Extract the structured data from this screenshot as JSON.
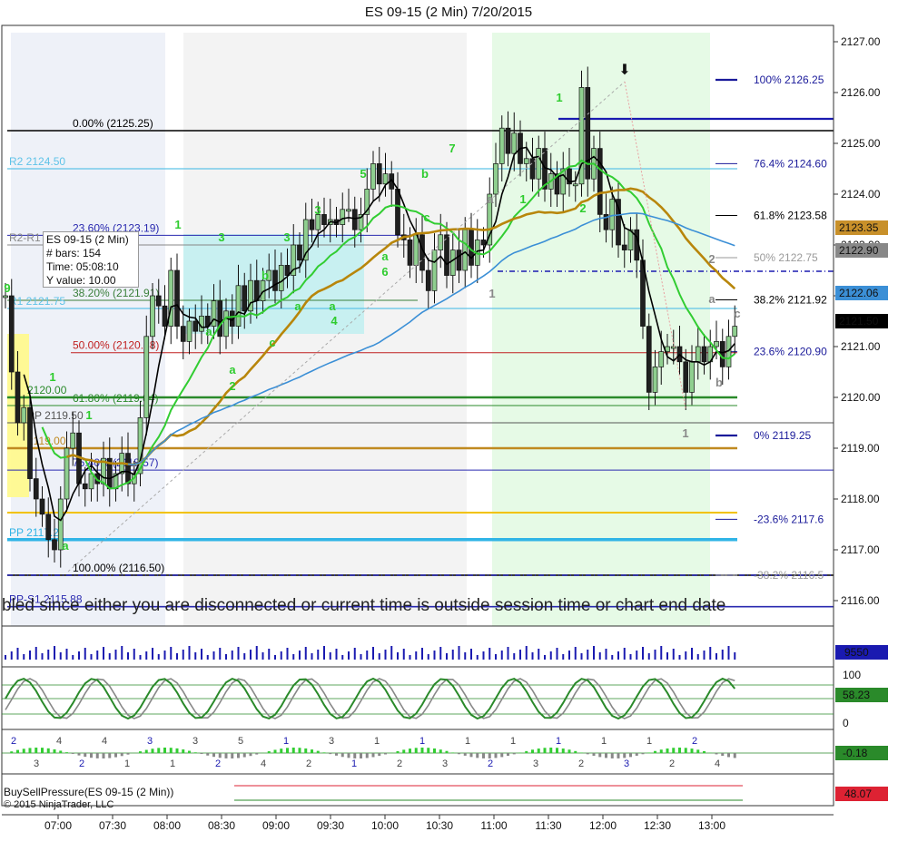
{
  "window": {
    "title": "ES 09-15 (2 Min)  7/20/2015"
  },
  "info_box": {
    "title": "ES 09-15 (2 Min)",
    "bars_label": "# bars:",
    "bars_value": "154",
    "time_label": "Time:",
    "time_value": "05:08:10",
    "yvalue_label": "Y value:",
    "yvalue_value": "10.00"
  },
  "banner": "bled since either you are disconnected or current time is outside session time or chart end date",
  "copyright": "© 2015 NinjaTrader, LLC",
  "colors": {
    "candle_up": "#8fcf8f",
    "candle_down": "#1f1f1f",
    "sma_short": "#000000",
    "sma_green": "#32cd32",
    "sma_brown": "#b8860b",
    "sma_blue": "#3b8fd6",
    "zone_lightblue": "#bfeff0",
    "zone_green": "#e6fae6",
    "zone_gray": "#f3f3f3",
    "zone_yellow": "#fff98a"
  },
  "chart_data": {
    "type": "candlestick",
    "instrument": "ES 09-15",
    "interval": "2 Min",
    "date": "7/20/2015",
    "ylim": [
      2115.9,
      2127.2
    ],
    "y_ticks": [
      "2127.00",
      "2126.00",
      "2125.00",
      "2124.00",
      "2123.00",
      "2122.00",
      "2121.00",
      "2120.00",
      "2119.00",
      "2118.00",
      "2117.00",
      "2116.00"
    ],
    "x_ticks": [
      "07:00",
      "07:30",
      "08:00",
      "08:30",
      "09:00",
      "09:30",
      "10:00",
      "10:30",
      "11:00",
      "11:30",
      "12:00",
      "12:30",
      "13:00"
    ],
    "close_path": [
      2122.0,
      2120.5,
      2119.5,
      2119.8,
      2118.4,
      2118.0,
      2117.7,
      2117.2,
      2117.0,
      2118.0,
      2119.0,
      2119.3,
      2118.3,
      2118.2,
      2118.5,
      2118.3,
      2118.8,
      2118.2,
      2118.5,
      2118.9,
      2118.3,
      2118.5,
      2119.6,
      2121.2,
      2122.0,
      2121.8,
      2121.4,
      2122.5,
      2121.4,
      2121.1,
      2121.5,
      2121.3,
      2121.6,
      2121.4,
      2121.9,
      2121.2,
      2121.7,
      2121.4,
      2122.2,
      2121.7,
      2122.3,
      2121.9,
      2122.3,
      2122.5,
      2122.1,
      2122.6,
      2122.4,
      2123.0,
      2122.7,
      2123.5,
      2123.3,
      2123.6,
      2123.4,
      2123.5,
      2123.4,
      2123.7,
      2123.7,
      2123.3,
      2123.6,
      2124.1,
      2124.6,
      2124.2,
      2124.4,
      2124.1,
      2123.2,
      2123.1,
      2122.6,
      2123.2,
      2122.5,
      2122.1,
      2122.9,
      2123.2,
      2122.4,
      2122.9,
      2122.5,
      2123.3,
      2122.6,
      2123.1,
      2123.0,
      2124.0,
      2124.6,
      2125.3,
      2124.8,
      2125.2,
      2124.6,
      2124.7,
      2124.3,
      2124.9,
      2124.1,
      2124.4,
      2124.0,
      2124.5,
      2124.2,
      2124.2,
      2126.1,
      2124.3,
      2124.9,
      2123.6,
      2123.3,
      2123.9,
      2123.0,
      2122.9,
      2123.3,
      2122.7,
      2121.4,
      2120.1,
      2120.6,
      2120.9,
      2121.0,
      2121.0,
      2120.7,
      2120.1,
      2120.7,
      2121.0,
      2120.7,
      2121.0,
      2121.1,
      2120.6,
      2121.2,
      2121.4
    ],
    "x_range": [
      "06:00",
      "13:20"
    ],
    "y_panel_labels": {
      "r2": "2123.35",
      "r3": "2122.90",
      "r4": "2122.06",
      "r5": "2121.50"
    },
    "levels": [
      {
        "label": "0.00% (2125.25)",
        "price": 2125.25,
        "color": "#000000"
      },
      {
        "label": "R2 2124.50",
        "price": 2124.5,
        "color": "#5fc3e8"
      },
      {
        "label": "23.60% (2123.19)",
        "price": 2123.19,
        "color": "#2a2ab0"
      },
      {
        "label": "R2-R1",
        "price": 2123.0,
        "color": "#888888"
      },
      {
        "label": "38.20% (2121.91)",
        "price": 2121.91,
        "color": "#3a7f3a"
      },
      {
        "label": "R1 2121.75",
        "price": 2121.75,
        "color": "#5fc3e8"
      },
      {
        "label": "50.00% (2120.88)",
        "price": 2120.88,
        "color": "#c02020"
      },
      {
        "label": "2120.00",
        "price": 2120.0,
        "color": "#2a8a2a"
      },
      {
        "label": "61.80% (2119.84)",
        "price": 2119.84,
        "color": "#2a8a2a"
      },
      {
        "label": "PP 2119.50",
        "price": 2119.5,
        "color": "#555555"
      },
      {
        "label": "2119.00",
        "price": 2119.0,
        "color": "#c08a20"
      },
      {
        "label": "76.40% (2118.57)",
        "price": 2118.57,
        "color": "#2a2ab0"
      },
      {
        "label": "PP 2117.2",
        "price": 2117.2,
        "color": "#30b4e6"
      },
      {
        "label": "100.00% (2116.50)",
        "price": 2116.5,
        "color": "#000000"
      },
      {
        "label": "PP-S1 2115.88",
        "price": 2115.88,
        "color": "#2a2ab0"
      }
    ],
    "right_fib": [
      {
        "label": "100%  2126.25",
        "price": 2126.25,
        "color": "#1a1a9a"
      },
      {
        "label": "76.4%  2124.60",
        "price": 2124.6,
        "color": "#1a1a9a"
      },
      {
        "label": "61.8%  2123.58",
        "price": 2123.58,
        "color": "#000000"
      },
      {
        "label": "50%  2122.75",
        "price": 2122.75,
        "color": "#9a9a9a"
      },
      {
        "label": "38.2%  2121.92",
        "price": 2121.92,
        "color": "#000000"
      },
      {
        "label": "23.6%  2120.90",
        "price": 2120.9,
        "color": "#1a1a9a"
      },
      {
        "label": "0%  2119.25",
        "price": 2119.25,
        "color": "#1a1a9a"
      },
      {
        "label": "-23.6%  2117.6",
        "price": 2117.6,
        "color": "#1a1a9a"
      },
      {
        "label": "-38.2%  2116.5",
        "price": 2116.5,
        "color": "#9a9a9a"
      }
    ],
    "wave_labels": [
      {
        "t": "9",
        "c": "#2ecc2e"
      },
      {
        "t": "1",
        "c": "#2ecc2e"
      },
      {
        "t": "1",
        "c": "#2ecc2e"
      },
      {
        "t": "a",
        "c": "#2ecc2e"
      },
      {
        "t": "1",
        "c": "#2ecc2e"
      },
      {
        "t": "3",
        "c": "#2ecc2e"
      },
      {
        "t": "a",
        "c": "#2ecc2e"
      },
      {
        "t": "a",
        "c": "#2ecc2e"
      },
      {
        "t": "2",
        "c": "#2ecc2e"
      },
      {
        "t": "b",
        "c": "#2ecc2e"
      },
      {
        "t": "c",
        "c": "#2ecc2e"
      },
      {
        "t": "3",
        "c": "#2ecc2e"
      },
      {
        "t": "a",
        "c": "#2ecc2e"
      },
      {
        "t": "3",
        "c": "#2ecc2e"
      },
      {
        "t": "a",
        "c": "#2ecc2e"
      },
      {
        "t": "4",
        "c": "#2ecc2e"
      },
      {
        "t": "5",
        "c": "#2ecc2e"
      },
      {
        "t": "a",
        "c": "#2ecc2e"
      },
      {
        "t": "6",
        "c": "#2ecc2e"
      },
      {
        "t": "b",
        "c": "#2ecc2e"
      },
      {
        "t": "c",
        "c": "#2ecc2e"
      },
      {
        "t": "7",
        "c": "#2ecc2e"
      },
      {
        "t": "a",
        "c": "#888888"
      },
      {
        "t": "1",
        "c": "#2ecc2e"
      },
      {
        "t": "1",
        "c": "#888888"
      },
      {
        "t": "1",
        "c": "#2ecc2e"
      },
      {
        "t": "2",
        "c": "#2ecc2e"
      },
      {
        "t": "2",
        "c": "#888888"
      },
      {
        "t": "a",
        "c": "#888888"
      },
      {
        "t": "c",
        "c": "#888888"
      },
      {
        "t": "b",
        "c": "#888888"
      },
      {
        "t": "1",
        "c": "#888888"
      }
    ],
    "volume": {
      "last": "9550"
    },
    "stochastic": {
      "last": "58.23",
      "ticks": [
        "100",
        "0"
      ]
    },
    "oscillator": {
      "last": "-0.18",
      "labels": [
        "2",
        "3",
        "4",
        "2",
        "4",
        "1",
        "3",
        "1",
        "3",
        "2",
        "5",
        "4",
        "1",
        "2",
        "3",
        "1",
        "1",
        "2",
        "1",
        "3",
        "1",
        "2",
        "1",
        "3",
        "1",
        "2",
        "1",
        "3",
        "1",
        "2",
        "2",
        "4"
      ]
    },
    "buysell": {
      "title": "BuySellPressure(ES 09-15 (2 Min))",
      "last": "48.07"
    }
  }
}
